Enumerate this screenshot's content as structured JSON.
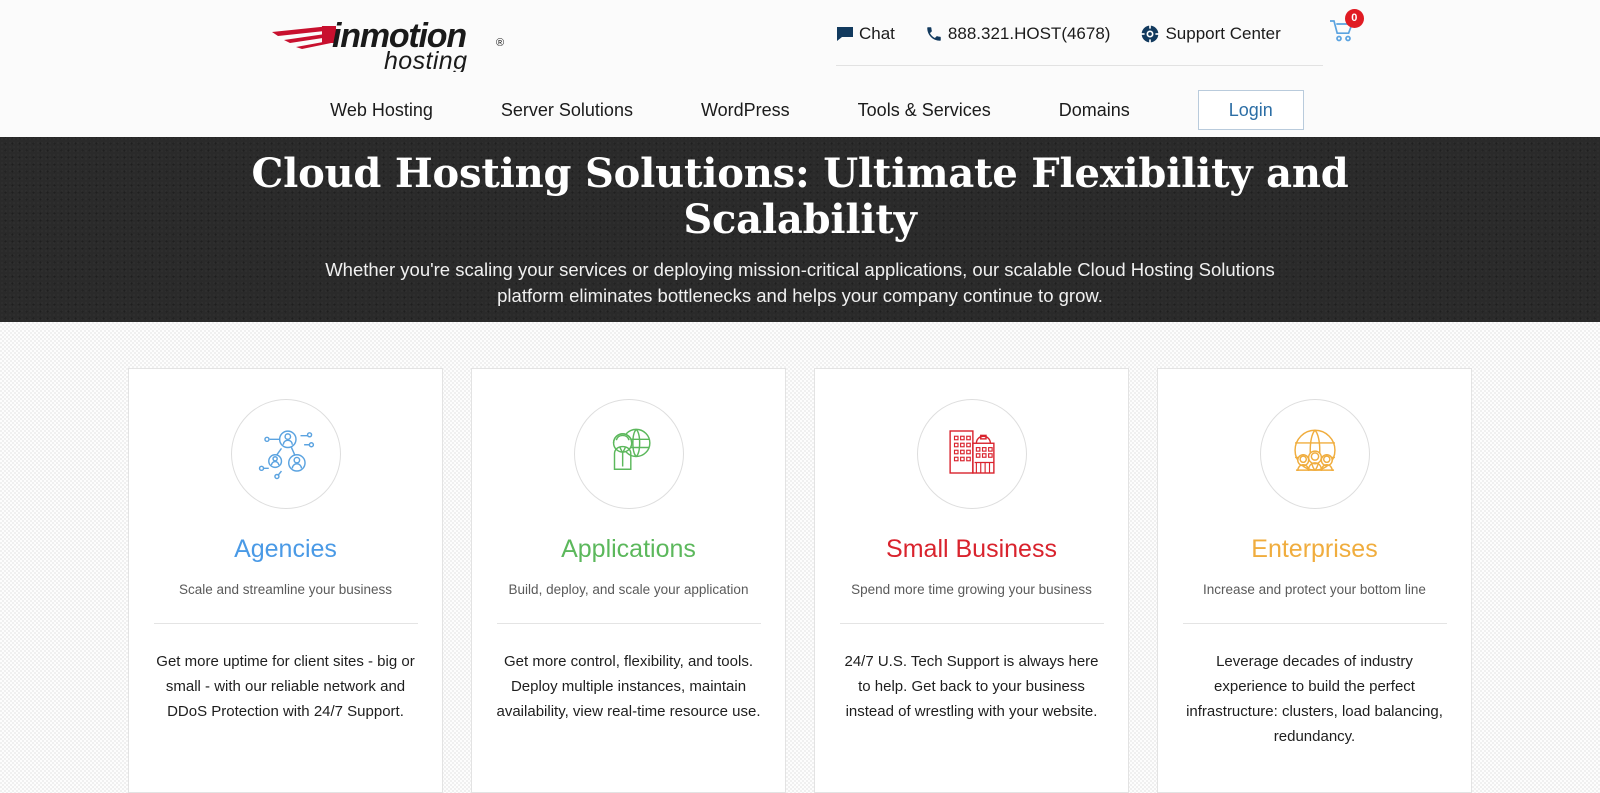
{
  "brand": {
    "logo_name": "inmotion",
    "logo_sub": "hosting",
    "logo_registered": "®",
    "logo_swoosh_color": "#c8102e"
  },
  "utility": {
    "items": [
      {
        "label": "Chat",
        "icon": "chat-bubble-icon"
      },
      {
        "label": "888.321.HOST(4678)",
        "icon": "phone-icon"
      },
      {
        "label": "Support Center",
        "icon": "lifebuoy-icon"
      }
    ],
    "cart": {
      "icon": "shopping-cart-icon",
      "badge_count": "0",
      "badge_color": "#e01b23"
    }
  },
  "nav": {
    "items": [
      {
        "label": "Web Hosting"
      },
      {
        "label": "Server Solutions"
      },
      {
        "label": "WordPress"
      },
      {
        "label": "Tools & Services"
      },
      {
        "label": "Domains"
      }
    ],
    "login_label": "Login",
    "login_color": "#2c6ea5"
  },
  "hero": {
    "title": "Cloud Hosting Solutions: Ultimate Flexibility and Scalability",
    "subtitle": "Whether you're scaling your services or deploying mission-critical applications, our scalable Cloud Hosting Solutions platform eliminates bottlenecks and helps your company continue to grow.",
    "bg_color": "#2a2a2a"
  },
  "cards": [
    {
      "title": "Agencies",
      "color": "#4a9ae6",
      "icon": "network-users-icon",
      "tagline": "Scale and streamline your business",
      "body": "Get more uptime for client sites - big or small - with our reliable network and DDoS Protection with 24/7 Support."
    },
    {
      "title": "Applications",
      "color": "#5cb85c",
      "icon": "person-globe-icon",
      "tagline": "Build, deploy, and scale your application",
      "body": "Get more control, flexibility, and tools. Deploy multiple instances, maintain availability, view real-time resource use."
    },
    {
      "title": "Small Business",
      "color": "#d9232d",
      "icon": "storefront-buildings-icon",
      "tagline": "Spend more time growing your business",
      "body": "24/7 U.S. Tech Support is always here to help. Get back to your business instead of wrestling with your website."
    },
    {
      "title": "Enterprises",
      "color": "#f0ad3e",
      "icon": "globe-people-icon",
      "tagline": "Increase and protect your bottom line",
      "body": "Leverage decades of industry experience to build the perfect infrastructure: clusters, load balancing, redundancy."
    }
  ]
}
